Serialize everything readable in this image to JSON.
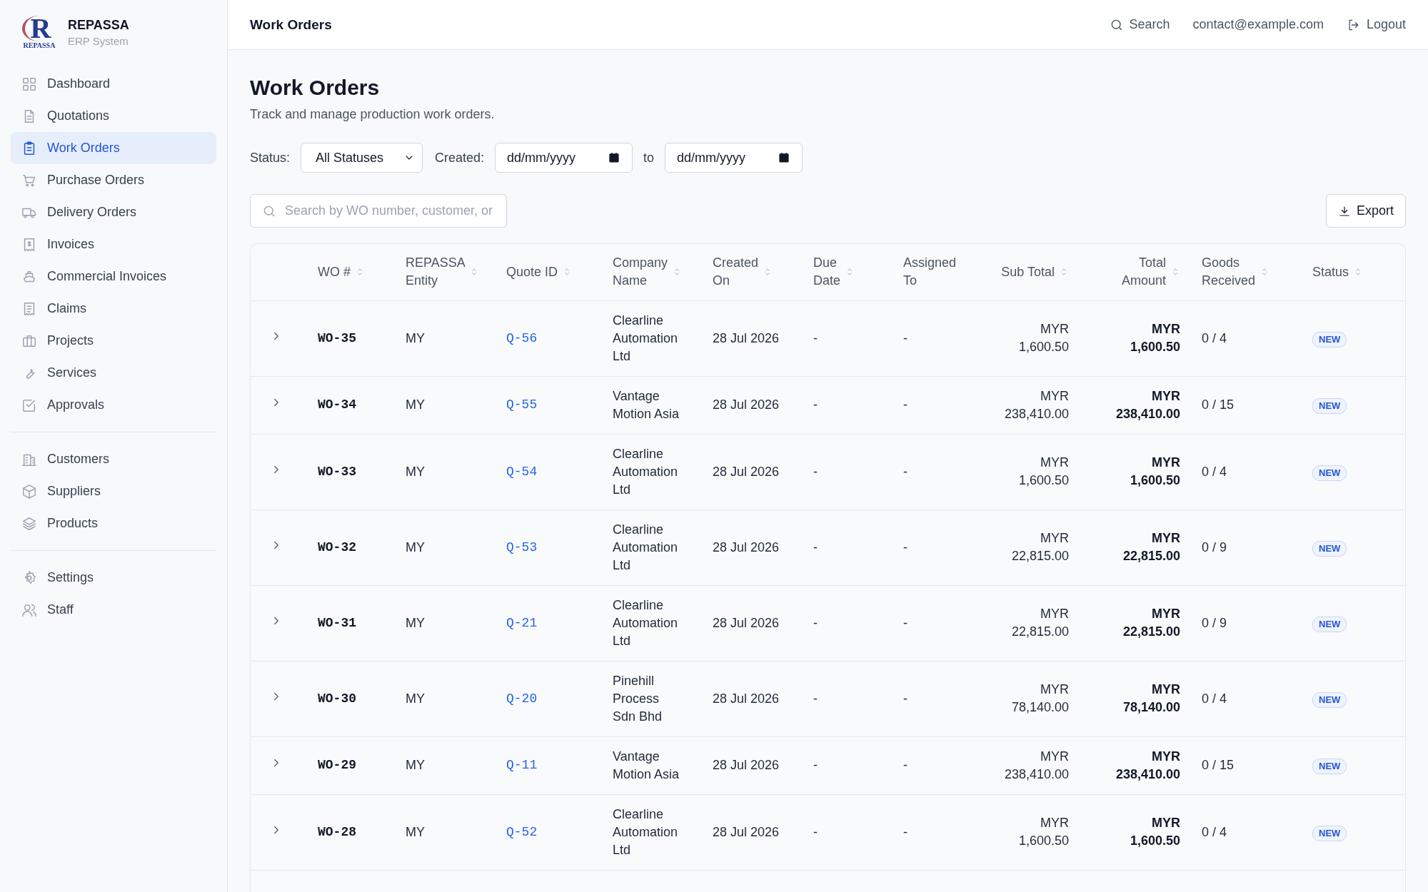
{
  "brand": {
    "logo_letter": "R",
    "logo_caption": "REPASSA",
    "name": "REPASSA",
    "subtitle": "ERP System"
  },
  "sidebar": {
    "groups": [
      [
        {
          "label": "Dashboard",
          "selected": false
        },
        {
          "label": "Quotations",
          "selected": false
        },
        {
          "label": "Work Orders",
          "selected": true
        },
        {
          "label": "Purchase Orders",
          "selected": false
        },
        {
          "label": "Delivery Orders",
          "selected": false
        },
        {
          "label": "Invoices",
          "selected": false
        },
        {
          "label": "Commercial Invoices",
          "selected": false
        },
        {
          "label": "Claims",
          "selected": false
        },
        {
          "label": "Projects",
          "selected": false
        },
        {
          "label": "Services",
          "selected": false
        },
        {
          "label": "Approvals",
          "selected": false
        }
      ],
      [
        {
          "label": "Customers",
          "selected": false
        },
        {
          "label": "Suppliers",
          "selected": false
        },
        {
          "label": "Products",
          "selected": false
        }
      ],
      [
        {
          "label": "Settings",
          "selected": false
        },
        {
          "label": "Staff",
          "selected": false
        }
      ]
    ]
  },
  "topbar": {
    "title": "Work Orders",
    "search": "Search",
    "email": "contact@example.com",
    "logout": "Logout"
  },
  "page": {
    "title": "Work Orders",
    "subtitle": "Track and manage production work orders."
  },
  "filters": {
    "status_label": "Status:",
    "status_value": "All Statuses",
    "created_label": "Created:",
    "from_placeholder": "dd/mm/yyyy",
    "to_label": "to",
    "to_placeholder": "dd/mm/yyyy"
  },
  "search": {
    "placeholder": "Search by WO number, customer, or"
  },
  "export_button": "Export",
  "table": {
    "columns": [
      {
        "label": "WO #",
        "sortable": true
      },
      {
        "label": "REPASSA Entity",
        "sortable": true
      },
      {
        "label": "Quote ID",
        "sortable": true
      },
      {
        "label": "Company Name",
        "sortable": true
      },
      {
        "label": "Created On",
        "sortable": true
      },
      {
        "label": "Due Date",
        "sortable": true
      },
      {
        "label": "Assigned To",
        "sortable": false
      },
      {
        "label": "Sub Total",
        "sortable": true
      },
      {
        "label": "Total Amount",
        "sortable": true
      },
      {
        "label": "Goods Received",
        "sortable": true
      },
      {
        "label": "Status",
        "sortable": true
      }
    ],
    "rows": [
      {
        "wo": "WO-35",
        "entity": "MY",
        "quote": "Q-56",
        "company": "Clearline Automation Ltd",
        "created": "28 Jul 2026",
        "due": "-",
        "assigned": "-",
        "sub_total": "MYR 1,600.50",
        "total": "MYR 1,600.50",
        "goods": "0 / 4",
        "status": "NEW"
      },
      {
        "wo": "WO-34",
        "entity": "MY",
        "quote": "Q-55",
        "company": "Vantage Motion Asia",
        "created": "28 Jul 2026",
        "due": "-",
        "assigned": "-",
        "sub_total": "MYR 238,410.00",
        "total": "MYR 238,410.00",
        "goods": "0 / 15",
        "status": "NEW"
      },
      {
        "wo": "WO-33",
        "entity": "MY",
        "quote": "Q-54",
        "company": "Clearline Automation Ltd",
        "created": "28 Jul 2026",
        "due": "-",
        "assigned": "-",
        "sub_total": "MYR 1,600.50",
        "total": "MYR 1,600.50",
        "goods": "0 / 4",
        "status": "NEW"
      },
      {
        "wo": "WO-32",
        "entity": "MY",
        "quote": "Q-53",
        "company": "Clearline Automation Ltd",
        "created": "28 Jul 2026",
        "due": "-",
        "assigned": "-",
        "sub_total": "MYR 22,815.00",
        "total": "MYR 22,815.00",
        "goods": "0 / 9",
        "status": "NEW"
      },
      {
        "wo": "WO-31",
        "entity": "MY",
        "quote": "Q-21",
        "company": "Clearline Automation Ltd",
        "created": "28 Jul 2026",
        "due": "-",
        "assigned": "-",
        "sub_total": "MYR 22,815.00",
        "total": "MYR 22,815.00",
        "goods": "0 / 9",
        "status": "NEW"
      },
      {
        "wo": "WO-30",
        "entity": "MY",
        "quote": "Q-20",
        "company": "Pinehill Process Sdn Bhd",
        "created": "28 Jul 2026",
        "due": "-",
        "assigned": "-",
        "sub_total": "MYR 78,140.00",
        "total": "MYR 78,140.00",
        "goods": "0 / 4",
        "status": "NEW"
      },
      {
        "wo": "WO-29",
        "entity": "MY",
        "quote": "Q-11",
        "company": "Vantage Motion Asia",
        "created": "28 Jul 2026",
        "due": "-",
        "assigned": "-",
        "sub_total": "MYR 238,410.00",
        "total": "MYR 238,410.00",
        "goods": "0 / 15",
        "status": "NEW"
      },
      {
        "wo": "WO-28",
        "entity": "MY",
        "quote": "Q-52",
        "company": "Clearline Automation Ltd",
        "created": "28 Jul 2026",
        "due": "-",
        "assigned": "-",
        "sub_total": "MYR 1,600.50",
        "total": "MYR 1,600.50",
        "goods": "0 / 4",
        "status": "NEW"
      }
    ]
  }
}
